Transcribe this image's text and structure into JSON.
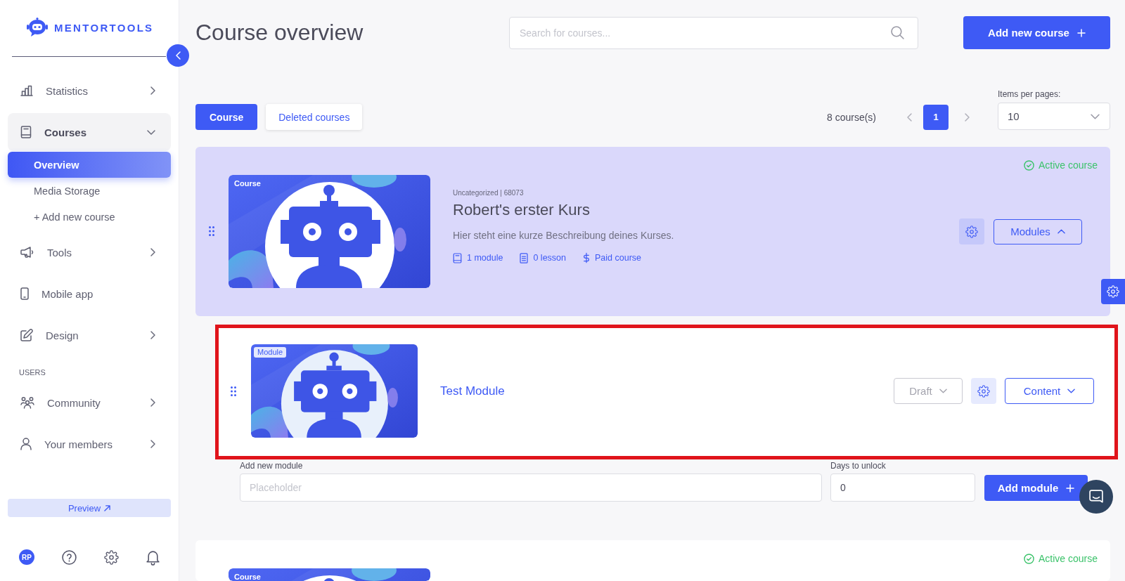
{
  "sidebar": {
    "logo": "MENTORTOOLS",
    "sections": [
      {
        "items": [
          {
            "kind": "menu",
            "label": "Statistics",
            "expanded": false
          },
          {
            "kind": "menu",
            "label": "Courses",
            "expanded": true,
            "children": [
              {
                "label": "Overview",
                "selected": true
              },
              {
                "label": "Media Storage",
                "selected": false
              },
              {
                "label": "+ Add new course",
                "selected": false
              }
            ]
          },
          {
            "kind": "menu",
            "label": "Tools",
            "expanded": false
          },
          {
            "kind": "link",
            "label": "Mobile app"
          },
          {
            "kind": "menu",
            "label": "Design",
            "expanded": false
          }
        ]
      },
      {
        "heading": "USERS",
        "items": [
          {
            "kind": "menu",
            "label": "Community",
            "expanded": false
          },
          {
            "kind": "menu",
            "label": "Your members",
            "expanded": false
          }
        ]
      }
    ],
    "preview_button": "Preview",
    "avatar": "RP"
  },
  "header": {
    "title": "Course overview",
    "search": {
      "placeholder": "Search for courses..."
    },
    "add_button": "Add new course"
  },
  "toolbar": {
    "tabs": [
      {
        "label": "Course",
        "selected": true
      },
      {
        "label": "Deleted courses",
        "selected": false
      }
    ],
    "count": "8 course(s)",
    "pages": [
      {
        "label": "1",
        "selected": true
      }
    ],
    "per_page": {
      "label": "Items per pages:",
      "value": "10"
    }
  },
  "courses": [
    {
      "tag": "Course",
      "status": "Active course",
      "category": "Uncategorized | 68073",
      "title": "Robert's erster Kurs",
      "description": "Hier steht eine kurze Beschreibung deines Kurses.",
      "stats": [
        "1 module",
        "0 lesson",
        "Paid course"
      ],
      "modules_button": "Modules",
      "expanded": true,
      "modules": [
        {
          "tag": "Module",
          "title": "Test Module",
          "status": "Draft",
          "content_button": "Content",
          "highlighted": true
        }
      ],
      "add_module": {
        "label": "Add new module",
        "placeholder": "Placeholder",
        "days_label": "Days to unlock",
        "days_value": "0",
        "button": "Add module"
      }
    },
    {
      "tag": "Course",
      "status": "Active course",
      "expanded": false
    }
  ]
}
